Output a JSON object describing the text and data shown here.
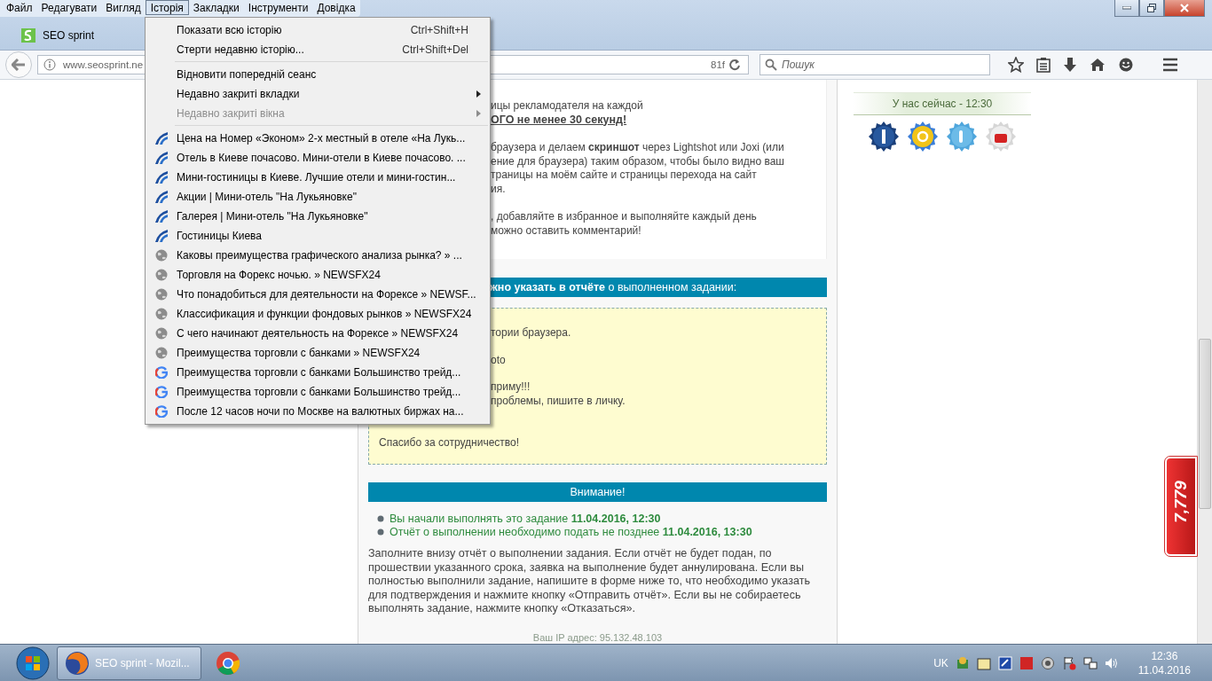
{
  "menubar": [
    {
      "label": "Файл",
      "selected": false
    },
    {
      "label": "Редагувати",
      "selected": false
    },
    {
      "label": "Вигляд",
      "selected": false
    },
    {
      "label": "Історія",
      "selected": true
    },
    {
      "label": "Закладки",
      "selected": false
    },
    {
      "label": "Інструменти",
      "selected": false
    },
    {
      "label": "Довідка",
      "selected": false
    }
  ],
  "tabs": [
    {
      "label": "SEO sprint",
      "selected": true
    }
  ],
  "address_bar": {
    "url_start": "www.seosprint.ne",
    "url_end": "81f"
  },
  "search": {
    "placeholder": "Пошук"
  },
  "history_menu": {
    "items": [
      {
        "kind": "command",
        "label": "Показати всю історію",
        "shortcut": "Ctrl+Shift+H",
        "disabled": false
      },
      {
        "kind": "command",
        "label": "Стерти недавню історію...",
        "shortcut": "Ctrl+Shift+Del",
        "disabled": false
      },
      {
        "kind": "separator"
      },
      {
        "kind": "command",
        "label": "Відновити попередній сеанс",
        "disabled": false
      },
      {
        "kind": "submenu",
        "label": "Недавно закриті вкладки",
        "disabled": false
      },
      {
        "kind": "submenu",
        "label": "Недавно закриті вікна",
        "disabled": true
      },
      {
        "kind": "separator"
      },
      {
        "kind": "hotel",
        "label": "Цена на Номер «Эконом» 2-х местный в отеле «На Лукь...",
        "disabled": false
      },
      {
        "kind": "hotel",
        "label": "Отель в Киеве почасово. Мини-отели в Киеве почасово. ...",
        "disabled": false
      },
      {
        "kind": "hotel",
        "label": "Мини-гостиницы в Киеве. Лучшие отели и мини-гостин...",
        "disabled": false
      },
      {
        "kind": "hotel",
        "label": "Акции | Мини-отель \"На Лукьяновке\"",
        "disabled": false
      },
      {
        "kind": "hotel",
        "label": "Галерея | Мини-отель \"На Лукьяновке\"",
        "disabled": false
      },
      {
        "kind": "hotel",
        "label": "Гостиницы Киева",
        "disabled": false
      },
      {
        "kind": "globe",
        "label": "Каковы преимущества графического анализа рынка? » ...",
        "disabled": false
      },
      {
        "kind": "globe",
        "label": "Торговля на Форекс ночью. » NEWSFX24",
        "disabled": false
      },
      {
        "kind": "globe",
        "label": "Что понадобиться для деятельности на Форексе » NEWSF...",
        "disabled": false
      },
      {
        "kind": "globe",
        "label": "Классификация и функции фондовых рынков » NEWSFX24",
        "disabled": false
      },
      {
        "kind": "globe",
        "label": "С чего начинают деятельность на Форексе » NEWSFX24",
        "disabled": false
      },
      {
        "kind": "globe",
        "label": "Преимущества торговли с банками » NEWSFX24",
        "disabled": false
      },
      {
        "kind": "google",
        "label": "Преимущества торговли с банками Большинство трейд...",
        "disabled": false
      },
      {
        "kind": "google",
        "label": "Преимущества торговли с банками Большинство трейд...",
        "disabled": false
      },
      {
        "kind": "google",
        "label": "После 12 часов ночи по Москве на валютных биржах на...",
        "disabled": false
      }
    ]
  },
  "page": {
    "intro": [
      {
        "partial": true,
        "lines": [
          {
            "text": "ицы рекламодателя на каждой",
            "strong": false
          },
          {
            "text": "ОГО не менее 30 секунд!",
            "strong": true
          }
        ]
      },
      {
        "partial": true,
        "lines": [
          {
            "text": "браузера и делаем **скриншот** через Lightshot или Joxi (или",
            "strong": false
          },
          {
            "text": "ение для браузера) таким образом, чтобы было видно ваш",
            "strong": false
          },
          {
            "text": "траницы на моём сайте и страницы перехода на сайт",
            "strong": false
          },
          {
            "text": "ия.",
            "strong": false
          }
        ]
      },
      {
        "partial": true,
        "lines": [
          {
            "text": ", добавляйте в избранное и выполняйте каждый день",
            "strong": false
          },
          {
            "text": "можно оставить комментарий!",
            "strong": false
          }
        ]
      }
    ],
    "report_header": "**жно указать в отчёте** о выполненном задании:",
    "report_box": [
      {
        "partial": true,
        "lines": [
          {
            "text": "тории браузера.",
            "strong": false
          }
        ]
      },
      {
        "partial": true,
        "lines": [
          {
            "text": "oto",
            "strong": false
          }
        ]
      },
      {
        "partial": true,
        "lines": [
          {
            "text": "приму!!!",
            "strong": false
          },
          {
            "text": "проблемы, пишите в личку.",
            "strong": false
          }
        ]
      },
      {
        "partial": false,
        "lines": [
          {
            "text": "Спасибо за сотрудничество!",
            "strong": false
          }
        ]
      }
    ],
    "attention": {
      "title": "Внимание!",
      "items": [
        "Вы начали выполнять это задание **11.04.2016, 12:30**",
        "Отчёт о выполнении необходимо подать не позднее **11.04.2016, 13:30**"
      ]
    },
    "note": "Заполните внизу отчёт о выполнении задания. Если отчёт не будет подан, по прошествии указанного срока, заявка на выполнение будет аннулирована. Если вы полностью выполнили задание, напишите в форме ниже то, что необходимо указать для подтверждения и нажмите кнопку «Отправить отчёт». Если вы не собираетесь выполнять задание, нажмите кнопку «Отказаться».",
    "ip": "Ваш IP адрес: 95.132.48.103"
  },
  "sidebar": {
    "clock": "У нас сейчас - 12:30",
    "social": [
      {
        "kind": "facebook"
      },
      {
        "kind": "google"
      },
      {
        "kind": "twitter"
      },
      {
        "kind": "youtube"
      }
    ]
  },
  "badge": {
    "count": "7,779"
  },
  "taskbar": {
    "tasks": [
      {
        "kind": "firefox",
        "label": "SEO sprint - Mozil...",
        "selected": true
      },
      {
        "kind": "chrome",
        "selected": false
      }
    ],
    "language": "UK",
    "time": "12:36",
    "date": "11.04.2016"
  }
}
